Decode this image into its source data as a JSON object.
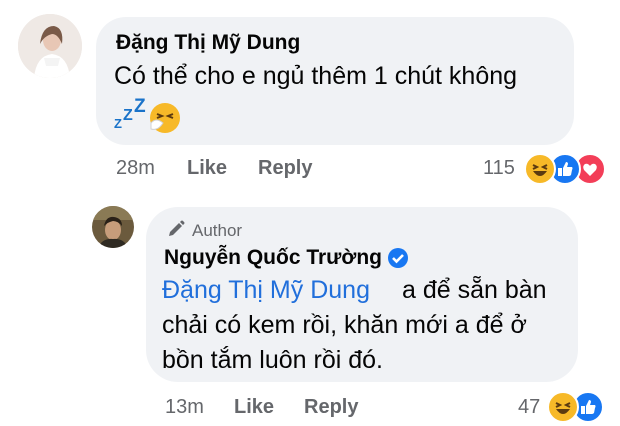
{
  "comment1": {
    "author": "Đặng Thị Mỹ Dung",
    "text": "Có thể cho e ngủ thêm 1 chút không",
    "emoji_icons": [
      "zzz-icon",
      "sneezing-face-icon"
    ],
    "time": "28m",
    "like_label": "Like",
    "reply_label": "Reply",
    "reaction_count": "115",
    "reaction_icons": [
      "haha-icon",
      "like-icon",
      "love-icon"
    ]
  },
  "reply1": {
    "badge": "Author",
    "author": "Nguyễn Quốc Trường",
    "verified_icon": "verified-badge-icon",
    "mention": "Đặng Thị Mỹ Dung",
    "text_line1": "a để sẵn bàn",
    "text_line2": "chải có kem rồi, khăn mới a để ở",
    "text_line3": "bồn tắm luôn rồi đó.",
    "time": "13m",
    "like_label": "Like",
    "reply_label": "Reply",
    "reaction_count": "47",
    "reaction_icons": [
      "haha-icon",
      "like-icon"
    ]
  },
  "colors": {
    "bubble": "#f0f2f5",
    "mention": "#216fdb",
    "meta": "#65676b",
    "like_blue": "#1877f2",
    "love_red": "#f33e58",
    "haha_yellow": "#f7b928"
  }
}
